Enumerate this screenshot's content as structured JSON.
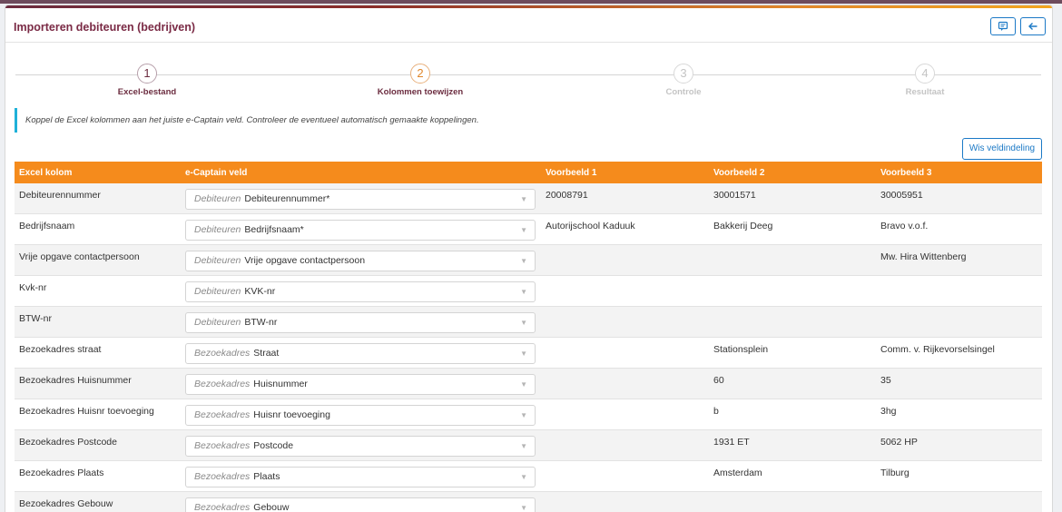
{
  "page": {
    "title": "Importeren debiteuren (bedrijven)"
  },
  "header": {
    "chat_icon": "chat-icon",
    "back_icon": "arrow-left-icon"
  },
  "steps": [
    {
      "num": "1",
      "label": "Excel-bestand",
      "state": "done"
    },
    {
      "num": "2",
      "label": "Kolommen toewijzen",
      "state": "active"
    },
    {
      "num": "3",
      "label": "Controle",
      "state": "pending"
    },
    {
      "num": "4",
      "label": "Resultaat",
      "state": "pending"
    }
  ],
  "info_text": "Koppel de Excel kolommen aan het juiste e-Captain veld. Controleer de eventueel automatisch gemaakte koppelingen.",
  "clear_button": "Wis veldindeling",
  "table": {
    "headers": [
      "Excel kolom",
      "e-Captain veld",
      "Voorbeeld 1",
      "Voorbeeld 2",
      "Voorbeeld 3"
    ],
    "rows": [
      {
        "excel": "Debiteurennummer",
        "group": "Debiteuren",
        "field": "Debiteurennummer*",
        "v1": "20008791",
        "v2": "30001571",
        "v3": "30005951"
      },
      {
        "excel": "Bedrijfsnaam",
        "group": "Debiteuren",
        "field": "Bedrijfsnaam*",
        "v1": "Autorijschool Kaduuk",
        "v2": "Bakkerij Deeg",
        "v3": "Bravo v.o.f."
      },
      {
        "excel": "Vrije opgave contactpersoon",
        "group": "Debiteuren",
        "field": "Vrije opgave contactpersoon",
        "v1": "",
        "v2": "",
        "v3": "Mw. Hira Wittenberg"
      },
      {
        "excel": "Kvk-nr",
        "group": "Debiteuren",
        "field": "KVK-nr",
        "v1": "",
        "v2": "",
        "v3": ""
      },
      {
        "excel": "BTW-nr",
        "group": "Debiteuren",
        "field": "BTW-nr",
        "v1": "",
        "v2": "",
        "v3": ""
      },
      {
        "excel": "Bezoekadres straat",
        "group": "Bezoekadres",
        "field": "Straat",
        "v1": "",
        "v2": "Stationsplein",
        "v3": "Comm. v. Rijkevorselsingel"
      },
      {
        "excel": "Bezoekadres Huisnummer",
        "group": "Bezoekadres",
        "field": "Huisnummer",
        "v1": "",
        "v2": "60",
        "v3": "35"
      },
      {
        "excel": "Bezoekadres Huisnr toevoeging",
        "group": "Bezoekadres",
        "field": "Huisnr toevoeging",
        "v1": "",
        "v2": "b",
        "v3": "3hg"
      },
      {
        "excel": "Bezoekadres Postcode",
        "group": "Bezoekadres",
        "field": "Postcode",
        "v1": "",
        "v2": "1931 ET",
        "v3": "5062 HP"
      },
      {
        "excel": "Bezoekadres Plaats",
        "group": "Bezoekadres",
        "field": "Plaats",
        "v1": "",
        "v2": "Amsterdam",
        "v3": "Tilburg"
      },
      {
        "excel": "Bezoekadres Gebouw",
        "group": "Bezoekadres",
        "field": "Gebouw",
        "v1": "",
        "v2": "",
        "v3": ""
      }
    ]
  }
}
